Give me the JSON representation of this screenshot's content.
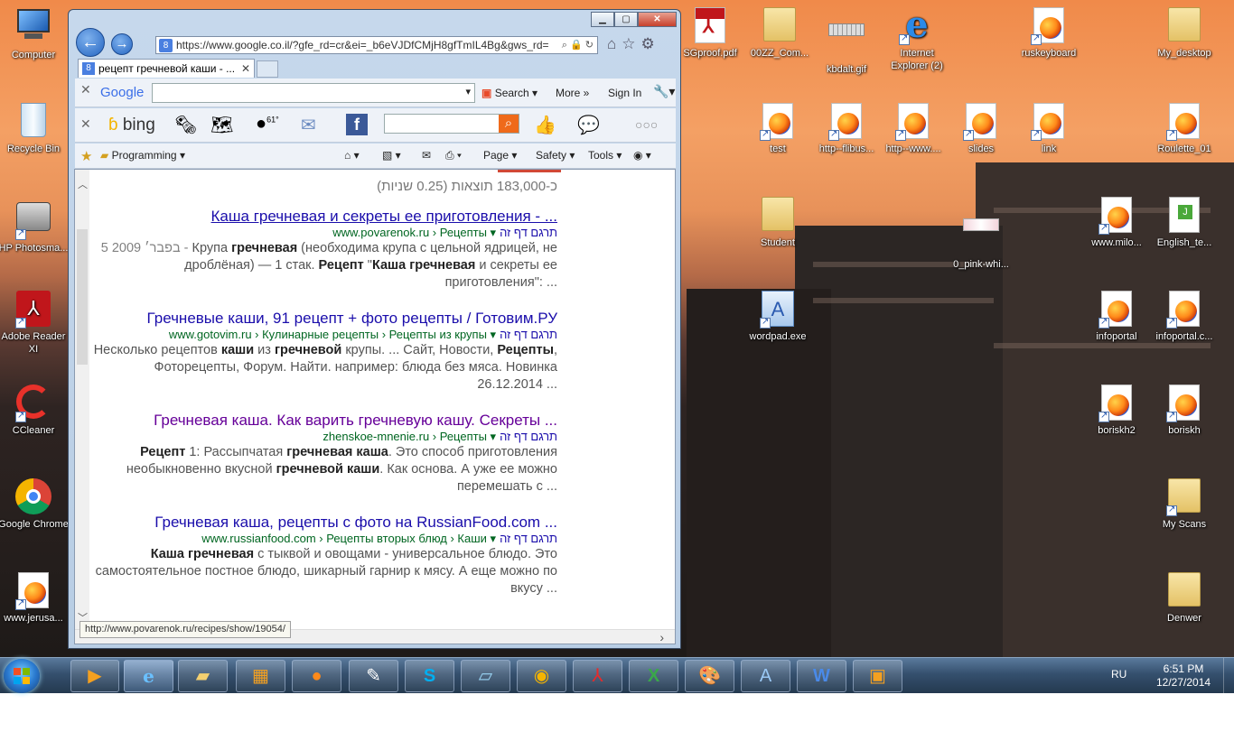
{
  "desktop_icons": {
    "computer": "Computer",
    "recycle": "Recycle Bin",
    "hp": "HP Photosma...",
    "adobe": "Adobe Reader XI",
    "ccleaner": "CCleaner",
    "chrome": "Google Chrome",
    "jerusalem": "www.jerusa...",
    "sgproof": "SGproof.pdf",
    "ozz": "00ZZ_Com...",
    "kbdalt": "kbdalt.gif",
    "ie": "Internet Explorer (2)",
    "ruskeyboard": "ruskeyboard",
    "mydesktop": "My_desktop",
    "test": "test",
    "flibus": "http--flibus...",
    "www": "http--www....",
    "slides": "slides",
    "link": "link",
    "roulette": "Roulette_01",
    "student": "Student",
    "pinkwhi": "0_pink-whi...",
    "milo": "www.milo...",
    "englishte": "English_te...",
    "wordpad": "wordpad.exe",
    "infoportal": "infoportal",
    "infoportalc": "infoportal.c...",
    "boriskh2": "boriskh2",
    "boriskh": "boriskh",
    "myscans": "My Scans",
    "denwer": "Denwer"
  },
  "browser": {
    "address": "https://www.google.co.il/?gfe_rd=cr&ei=_b6eVJDfCMjH8gfTmIL4Bg&gws_rd=",
    "tab_title": "рецепт гречневой каши - ...",
    "tab_close": "✕",
    "caption": {
      "min": "▁",
      "max": "▢",
      "close": "✕"
    },
    "google_toolbar": {
      "logo": "Google",
      "search_label": "Search",
      "more_label": "More",
      "signin_label": "Sign In"
    },
    "bing_toolbar": {
      "logo": "bing",
      "weather": "61°"
    },
    "command_bar": {
      "favorites_folder": "Programming",
      "page": "Page",
      "safety": "Safety",
      "tools": "Tools"
    }
  },
  "search": {
    "stats": "כ-183,000 תוצאות (0.25 שניות)",
    "translate_label": "תרגם דף זה",
    "results": [
      {
        "title": "Каша гречневая и секреты ее приготовления - ...",
        "cite": "www.povarenok.ru › Рецепты",
        "snippet_date": "5 בפבר׳ 2009 - ",
        "snippet_pre": "Крупа ",
        "snippet_b1": "гречневая",
        "snippet_mid": " (необходима крупа с цельной ядрицей, не дроблёная) — 1 стак. ",
        "snippet_b2": "Рецепт",
        "snippet_mid2": " \"",
        "snippet_b3": "Каша гречневая",
        "snippet_end": " и секреты ее приготовления\": ..."
      },
      {
        "title": "Гречневые каши, 91 рецепт + фото рецепты / Готовим.РУ",
        "cite": "www.gotovim.ru › Кулинарные рецепты › Рецепты из крупы",
        "snippet_pre": "Несколько рецептов ",
        "snippet_b1": "каши",
        "snippet_mid": " из ",
        "snippet_b2": "гречневой",
        "snippet_mid2": " крупы. ... Сайт, Новости, ",
        "snippet_b3": "Рецепты",
        "snippet_end": ", Фоторецепты, Форум. Найти. например: блюда без мяса. Новинка 26.12.2014 ..."
      },
      {
        "title": "Гречневая каша. Как варить гречневую кашу. Секреты ...",
        "cite": "zhenskoe-mnenie.ru › Рецепты",
        "snippet_pre": "",
        "snippet_b1": "Рецепт",
        "snippet_mid": " 1: Рассыпчатая ",
        "snippet_b2": "гречневая каша",
        "snippet_mid2": ". Это способ приготовления необыкновенно вкусной ",
        "snippet_b3": "гречневой каши",
        "snippet_end": ". Как основа. А уже ее можно перемешать с ..."
      },
      {
        "title": "Гречневая каша, рецепты с фото на RussianFood.com ...",
        "cite": "www.russianfood.com › Рецепты вторых блюд › Каши",
        "snippet_pre": "",
        "snippet_b1": "Каша гречневая",
        "snippet_mid": " с тыквой и овощами - универсальное блюдо. Это самостоятельное постное блюдо, шикарный гарнир к мясу. А еще можно по вкусу ...",
        "snippet_b2": "",
        "snippet_mid2": "",
        "snippet_b3": "",
        "snippet_end": ""
      }
    ],
    "status_url": "http://www.povarenok.ru/recipes/show/19054/"
  },
  "taskbar": {
    "lang": "RU",
    "time": "6:51 PM",
    "date": "12/27/2014"
  }
}
